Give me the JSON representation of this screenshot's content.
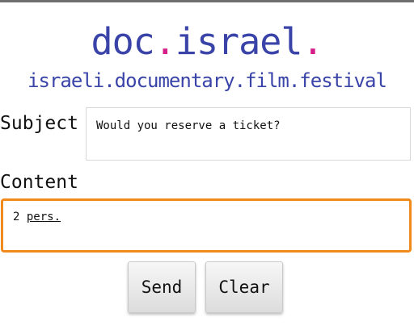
{
  "logo": {
    "main_part1": "doc",
    "main_dot1": ".",
    "main_part2": "israel",
    "main_dot2": ".",
    "tagline": "israeli.documentary.film.festival"
  },
  "form": {
    "subject_label": "Subject",
    "subject_value": "Would you reserve a ticket?",
    "content_label": "Content",
    "content_value_prefix": "2 ",
    "content_value_underlined": "pers."
  },
  "buttons": {
    "send_label": "Send",
    "clear_label": "Clear"
  },
  "colors": {
    "logo_blue": "#3a44a8",
    "logo_pink": "#d61e8a",
    "focus_orange": "#f18a1c"
  }
}
